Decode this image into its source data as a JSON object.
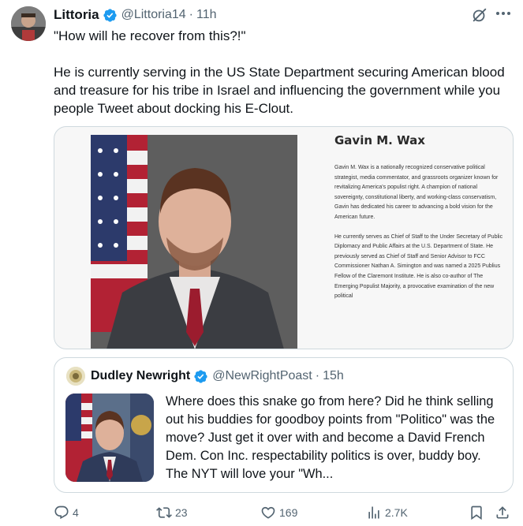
{
  "tweet": {
    "author_name": "Littoria",
    "author_handle": "@Littoria14",
    "separator": "·",
    "time": "11h",
    "text_line1": "\"How will he recover from this?!\"",
    "text_line2": "He is currently serving in the US State Department securing American blood and treasure for his tribe in Israel and influencing the government while you people Tweet about docking his E-Clout."
  },
  "media": {
    "bio_title": "Gavin M. Wax",
    "bio_p1": "Gavin M. Wax is a nationally recognized conservative political strategist, media commentator, and grassroots organizer known for revitalizing America's populist right. A champion of national sovereignty, constitutional liberty, and working-class conservatism, Gavin has dedicated his career to advancing a bold vision for the American future.",
    "bio_p2": "He currently serves as Chief of Staff to the Under Secretary of Public Diplomacy and Public Affairs at the U.S. Department of State. He previously served as Chief of Staff and Senior Advisor to FCC Commissioner Nathan A. Simington and was named a 2025 Publius Fellow of the Claremont Institute. He is also co-author of The Emerging Populist Majority, a provocative examination of the new political"
  },
  "quote": {
    "author_name": "Dudley Newright",
    "author_handle": "@NewRightPoast",
    "separator": "·",
    "time": "15h",
    "text": "Where does this snake go from here? Did he think selling out his buddies for goodboy points from \"Politico\" was the move? Just get it over with and become a David French Dem. Con Inc. respectability politics is over, buddy boy. The NYT will love your \"Wh..."
  },
  "actions": {
    "replies": "4",
    "reposts": "23",
    "likes": "169",
    "views": "2.7K"
  },
  "colors": {
    "verified": "#1d9bf0",
    "muted": "#536471",
    "border": "#cfd9de"
  },
  "icons": [
    "grok-icon",
    "more-icon",
    "reply-icon",
    "repost-icon",
    "like-icon",
    "views-icon",
    "bookmark-icon",
    "share-icon",
    "verified-badge-icon"
  ]
}
